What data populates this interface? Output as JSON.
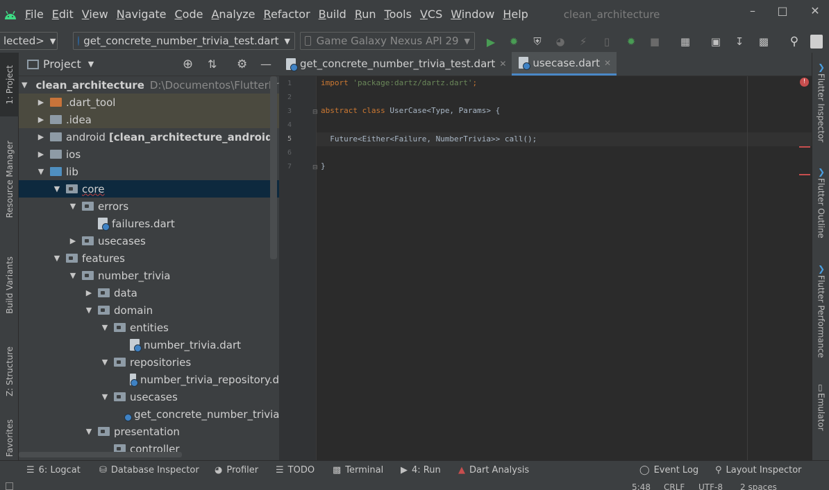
{
  "menubar": {
    "items": [
      "File",
      "Edit",
      "View",
      "Navigate",
      "Code",
      "Analyze",
      "Refactor",
      "Build",
      "Run",
      "Tools",
      "VCS",
      "Window",
      "Help"
    ],
    "window_title": "clean_architecture"
  },
  "toolbar": {
    "selector_partial": "lected>",
    "run_config": "get_concrete_number_trivia_test.dart",
    "device": "Game Galaxy Nexus API 29"
  },
  "left_strip": {
    "tabs": [
      "1: Project",
      "Resource Manager",
      "Build Variants",
      "Z: Structure",
      "Favorites"
    ]
  },
  "project": {
    "title": "Project",
    "tree": [
      {
        "label": "clean_architecture",
        "path": "D:\\Documentos\\FlutterPro"
      },
      {
        "label": ".dart_tool"
      },
      {
        "label": ".idea"
      },
      {
        "label": "android",
        "module": "[clean_architecture_android]"
      },
      {
        "label": "ios"
      },
      {
        "label": "lib"
      },
      {
        "label": "core"
      },
      {
        "label": "errors"
      },
      {
        "label": "failures.dart"
      },
      {
        "label": "usecases"
      },
      {
        "label": "features"
      },
      {
        "label": "number_trivia"
      },
      {
        "label": "data"
      },
      {
        "label": "domain"
      },
      {
        "label": "entities"
      },
      {
        "label": "number_trivia.dart"
      },
      {
        "label": "repositories"
      },
      {
        "label": "number_trivia_repository.d"
      },
      {
        "label": "usecases"
      },
      {
        "label": "get_concrete_number_trivia"
      },
      {
        "label": "presentation"
      },
      {
        "label": "controller"
      }
    ]
  },
  "editor": {
    "tabs": [
      {
        "label": "get_concrete_number_trivia_test.dart"
      },
      {
        "label": "usecase.dart"
      }
    ],
    "line_numbers": [
      "1",
      "2",
      "3",
      "4",
      "5",
      "6",
      "7"
    ],
    "lines": {
      "l1_kw": "import ",
      "l1_str": "'package:dartz/dartz.dart'",
      "l1_end": ";",
      "l3_kw": "abstract class ",
      "l3_rest": "UserCase<Type, Params> {",
      "l5": "  Future<Either<Failure, NumberTrivia>> call();",
      "l7": "}"
    }
  },
  "right_strip": {
    "tabs": [
      "Flutter Inspector",
      "Flutter Outline",
      "Flutter Performance",
      "Emulator"
    ]
  },
  "bottom_tools": [
    {
      "label": "6: Logcat"
    },
    {
      "label": "Database Inspector"
    },
    {
      "label": "Profiler"
    },
    {
      "label": "TODO"
    },
    {
      "label": "Terminal"
    },
    {
      "label": "4: Run"
    },
    {
      "label": "Dart Analysis"
    },
    {
      "label": "Event Log"
    },
    {
      "label": "Layout Inspector"
    }
  ],
  "status": {
    "position": "5:48",
    "line_sep": "CRLF",
    "encoding": "UTF-8",
    "indent": "2 spaces"
  },
  "colors": {
    "accent": "#4a88c7",
    "run_green": "#499c54",
    "error_red": "#c74e4e"
  }
}
